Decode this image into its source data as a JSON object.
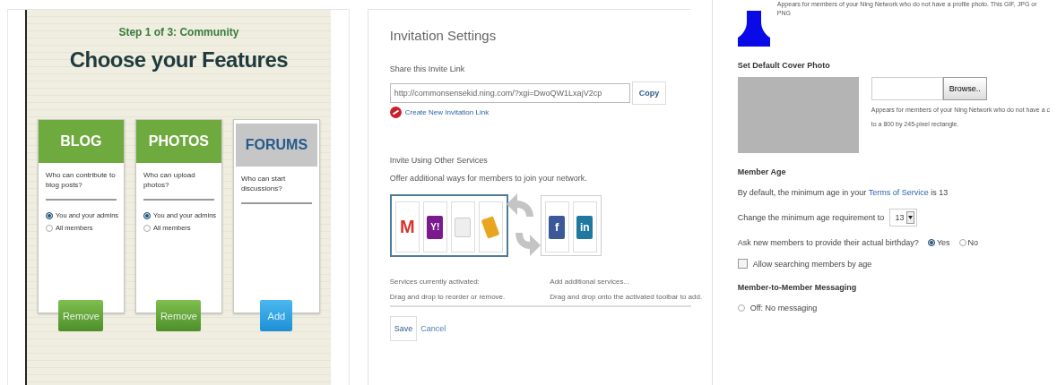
{
  "features_panel": {
    "step": "Step 1 of 3: Community",
    "heading": "Choose your Features",
    "cards": [
      {
        "title": "BLOG",
        "added": true,
        "question": "Who can contribute to blog posts?",
        "options": [
          {
            "label": "You and your admins",
            "selected": true
          },
          {
            "label": "All members",
            "selected": false
          }
        ],
        "button": {
          "label": "Remove",
          "kind": "remove"
        }
      },
      {
        "title": "PHOTOS",
        "added": true,
        "question": "Who can upload photos?",
        "options": [
          {
            "label": "You and your admins",
            "selected": true
          },
          {
            "label": "All members",
            "selected": false
          }
        ],
        "button": {
          "label": "Remove",
          "kind": "remove"
        }
      },
      {
        "title": "FORUMS",
        "added": false,
        "question": "Who can start discussions?",
        "button": {
          "label": "Add",
          "kind": "add"
        }
      }
    ]
  },
  "invitation_panel": {
    "title": "Invitation Settings",
    "share_label": "Share this Invite Link",
    "invite_link": {
      "value": "http://commonsensekid.ning.com/?xgi=DwoQW1LxajV2cp"
    },
    "copy_button": "Copy",
    "create_link": "Create New Invitation Link",
    "services_heading": "Invite Using Other Services",
    "services_description": "Offer additional ways for members to join your network.",
    "active_services": [
      {
        "kind": "gmail",
        "glyph": "M"
      },
      {
        "kind": "yahoo",
        "glyph": "Y!"
      },
      {
        "kind": "mail"
      },
      {
        "kind": "notebook"
      }
    ],
    "available_services": [
      {
        "kind": "facebook",
        "glyph": "f"
      },
      {
        "kind": "linkedin",
        "glyph": "in"
      }
    ],
    "active_caption": "Services currently activated:",
    "active_hint": "Drag and drop to reorder or remove.",
    "available_caption": "Add additional services...",
    "available_hint": "Drag and drop onto the activated toolbar to add.",
    "buttons": [
      {
        "label": "Save",
        "kind": "primary"
      },
      {
        "label": "Cancel",
        "kind": "link"
      }
    ]
  },
  "profile_panel": {
    "avatar_caption": "Appears for members of your Ning Network who do not have a profile photo. This GIF, JPG or PNG",
    "cover_heading": "Set Default Cover Photo",
    "browse_button": "Browse..",
    "cover_caption": [
      "Appears for members of your Ning Network who do not have a c",
      "to a 800 by 245-pixel rectangle."
    ],
    "age_heading": "Member Age",
    "age_default": {
      "before": "By default, the minimum age in your ",
      "link": "Terms of Service",
      "after": " is 13"
    },
    "age_requirement": {
      "label": "Change the minimum age requirement to",
      "value": "13"
    },
    "birthday": {
      "question": "Ask new members to provide their actual birthday?",
      "options": [
        {
          "label": "Yes",
          "selected": true
        },
        {
          "label": "No",
          "selected": false
        }
      ]
    },
    "age_search": {
      "label": "Allow searching members by age",
      "checked": false
    },
    "messaging_heading": "Member-to-Member Messaging",
    "messaging_options": [
      {
        "label": "Off: No messaging",
        "selected": false
      }
    ]
  }
}
